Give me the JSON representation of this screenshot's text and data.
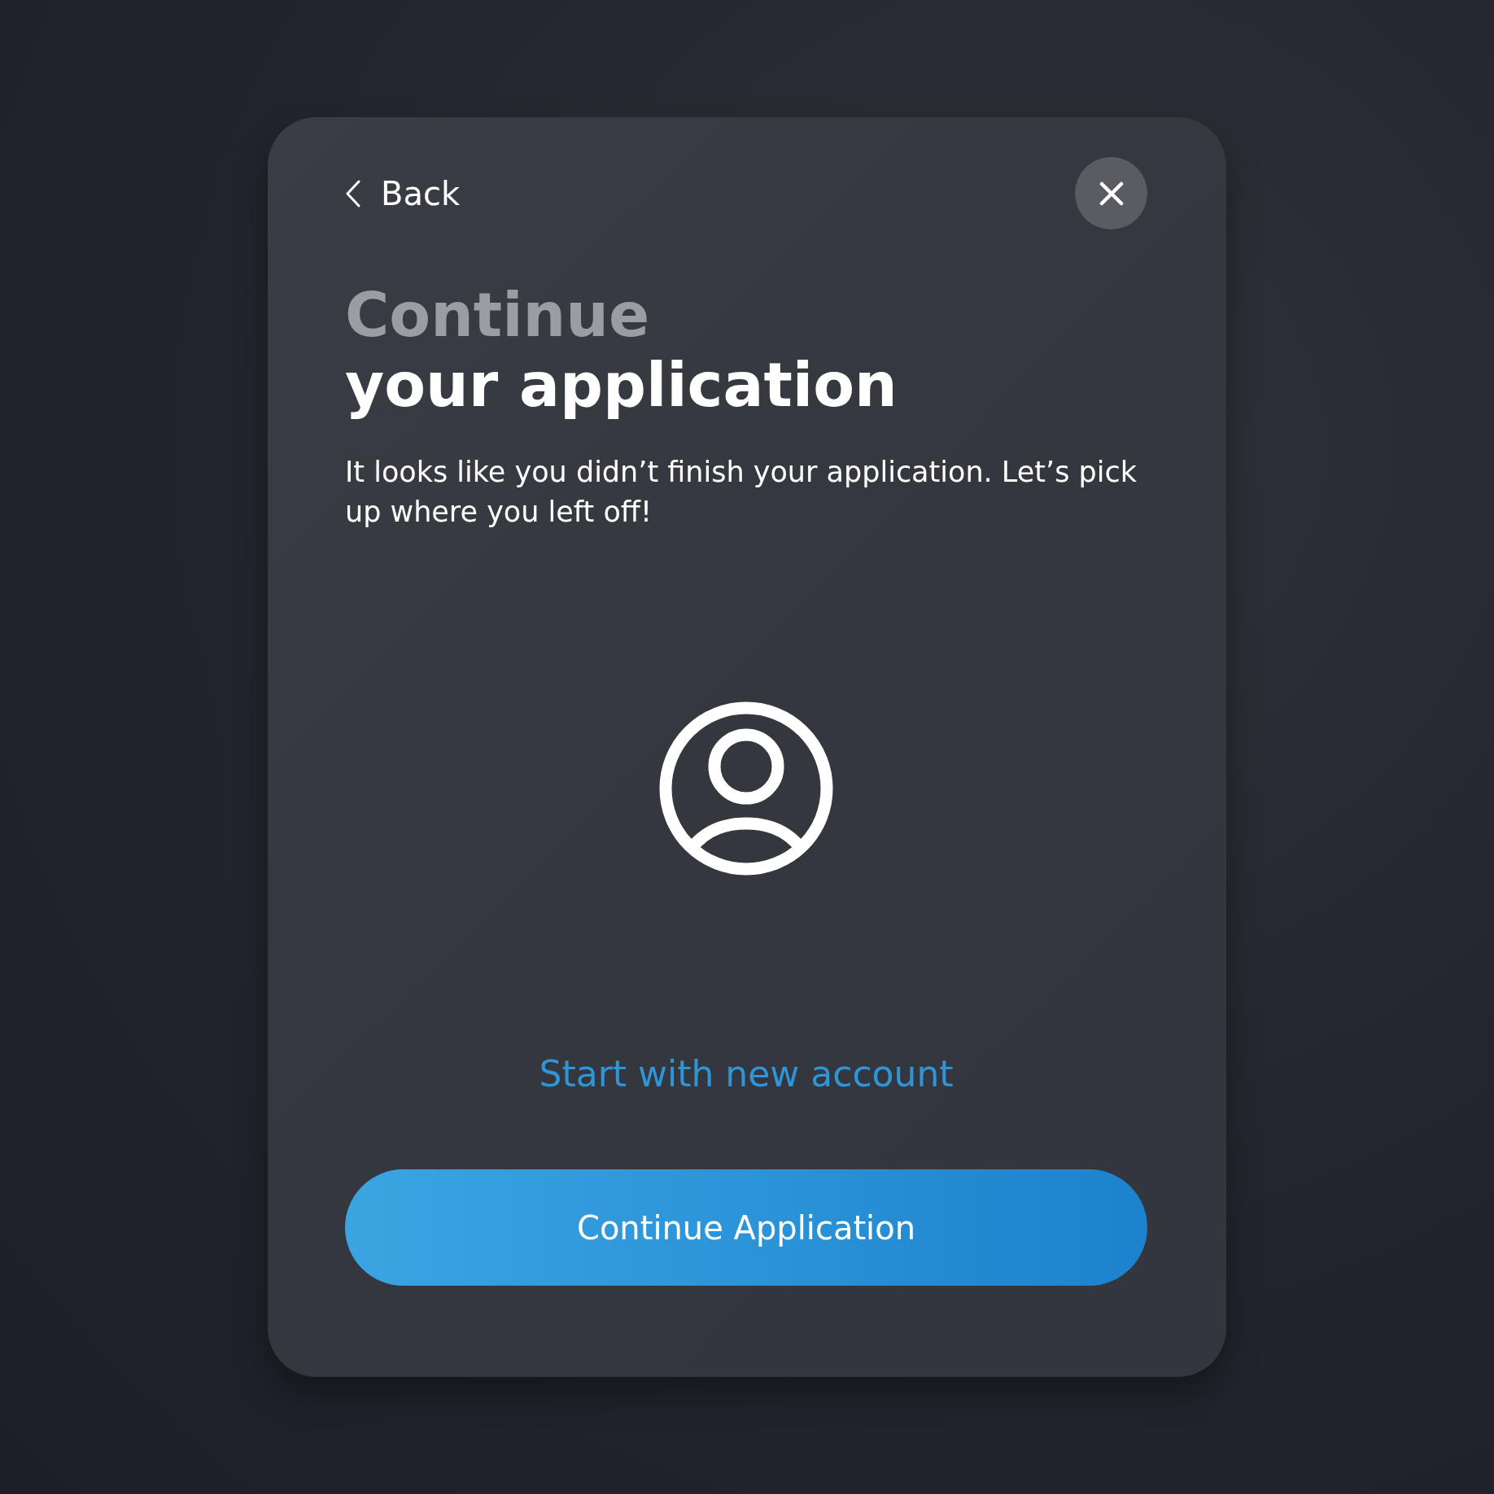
{
  "back": {
    "label": "Back"
  },
  "title": {
    "lead": "Continue",
    "main": "your application"
  },
  "message": "It looks like you didn’t finish your application. Let’s pick up where you left off!",
  "secondary_link": "Start with new account",
  "primary_button": "Continue Application"
}
